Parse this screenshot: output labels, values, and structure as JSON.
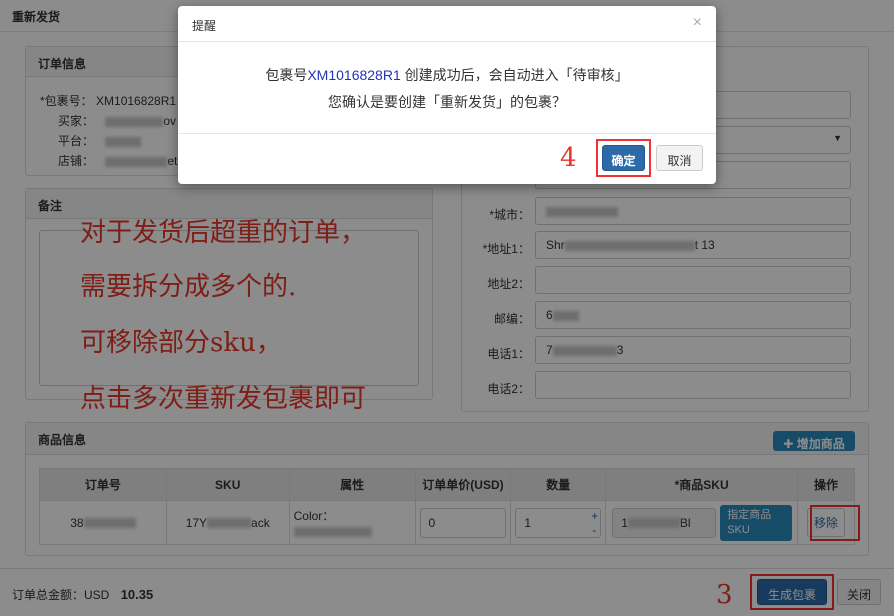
{
  "window": {
    "title": "重新发货"
  },
  "order_info": {
    "header": "订单信息",
    "package_label": "*包裹号：",
    "package_value": "XM1016828R1",
    "buyer_label": "买家：",
    "buyer_suffix": "ov",
    "platform_label": "平台：",
    "store_label": "店铺：",
    "store_suffix": "et"
  },
  "notes": {
    "header": "备注"
  },
  "address": {
    "city_label": "*城市：",
    "address1_label": "*地址1：",
    "address1_prefix": "Shr",
    "address1_suffix": "t 13",
    "address2_label": "地址2：",
    "zip_label": "邮编：",
    "zip_prefix": "6",
    "phone1_label": "电话1：",
    "phone1_prefix": "7",
    "phone1_suffix": "3",
    "phone2_label": "电话2："
  },
  "goods": {
    "header": "商品信息",
    "add_button": "增加商品",
    "columns": [
      "订单号",
      "SKU",
      "属性",
      "订单单价(USD)",
      "数量",
      "*商品SKU",
      "操作"
    ],
    "row": {
      "order_prefix": "38",
      "sku_prefix": "17Y",
      "sku_suffix": "ack",
      "attr_prefix": "Color：",
      "price": "0",
      "qty": "1",
      "goods_sku_prefix": "1",
      "goods_sku_suffix": "Bl",
      "assign_button": "指定商品SKU",
      "remove_button": "移除"
    }
  },
  "footer": {
    "total_label": "订单总金额：USD",
    "total_value": "10.35",
    "generate_button": "生成包裹",
    "close_button": "关闭"
  },
  "annotations": {
    "line1": "对于发货后超重的订单，",
    "line2": "需要拆分成多个的.",
    "line3": "可移除部分sku，",
    "line4": "点击多次重新发包裹即可",
    "step3": "3",
    "step4": "4"
  },
  "dialog": {
    "title": "提醒",
    "close_glyph": "×",
    "msg_prefix": "包裹号",
    "msg_package": "XM1016828R1",
    "msg_suffix": " 创建成功后，会自动进入「待审核」",
    "msg_line2": "您确认是要创建「重新发货」的包裹？",
    "confirm_button": "确定",
    "cancel_button": "取消"
  },
  "colors": {
    "accent": "#2d6aa8",
    "annotation": "#e8352a",
    "highlight": "#2233bb"
  }
}
